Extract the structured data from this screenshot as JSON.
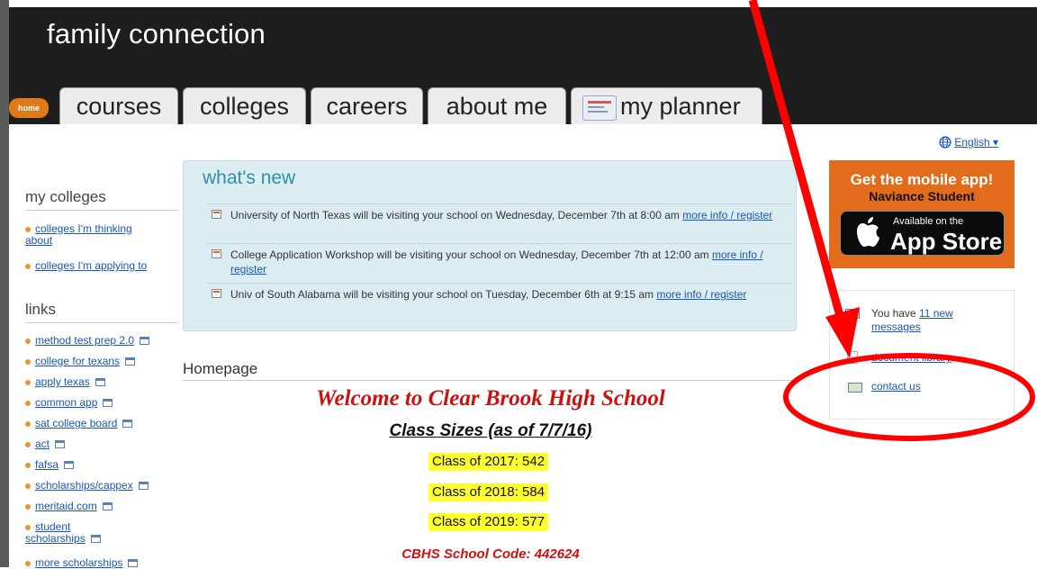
{
  "header": {
    "site_title": "family connection",
    "home_label": "home",
    "tabs": [
      {
        "label": "courses"
      },
      {
        "label": "colleges"
      },
      {
        "label": "careers"
      },
      {
        "label": "about me"
      },
      {
        "label": "my planner"
      }
    ]
  },
  "language": {
    "label": "English ▾"
  },
  "sidebar": {
    "my_colleges": {
      "heading": "my colleges",
      "items": [
        "colleges I'm thinking about",
        "colleges I'm applying to"
      ]
    },
    "links": {
      "heading": "links",
      "items": [
        "method test prep 2.0",
        "college for texans",
        "apply texas",
        "common app",
        "sat college board",
        "act",
        "fafsa",
        "scholarships/cappex",
        "meritaid.com",
        "student scholarships",
        "more scholarships"
      ]
    }
  },
  "whats_new": {
    "title": "what's new",
    "items": [
      {
        "text": "University of North Texas will be visiting your school on Wednesday, December 7th at 8:00 am ",
        "link": "more info / register"
      },
      {
        "text": "College Application Workshop will be visiting your school on Wednesday, December 7th at 12:00 am ",
        "link": "more info / register"
      },
      {
        "text": "Univ of South Alabama will be visiting your school on Tuesday, December 6th at 9:15 am ",
        "link": "more info / register"
      }
    ]
  },
  "homepage": {
    "title": "Homepage",
    "welcome": "Welcome to Clear Brook High School",
    "class_sizes_heading": "Class Sizes (as of 7/7/16)",
    "classes": [
      "Class of 2017: 542",
      "Class of 2018: 584",
      "Class of 2019: 577"
    ],
    "school_code": "CBHS School Code: 442624"
  },
  "mobile_banner": {
    "headline": "Get the mobile app!",
    "subline": "Naviance Student",
    "store_small": "Available on the",
    "store_big": "App Store",
    "bg_color": "#e26c1b"
  },
  "messages": {
    "prefix": "You have ",
    "count_link": "11 new messages",
    "document_library": "document library",
    "contact_us": "contact us"
  },
  "annotation": {
    "color": "#ff0000",
    "arrow": "red-arrow",
    "circle": "red-ellipse-around-contact-us"
  }
}
